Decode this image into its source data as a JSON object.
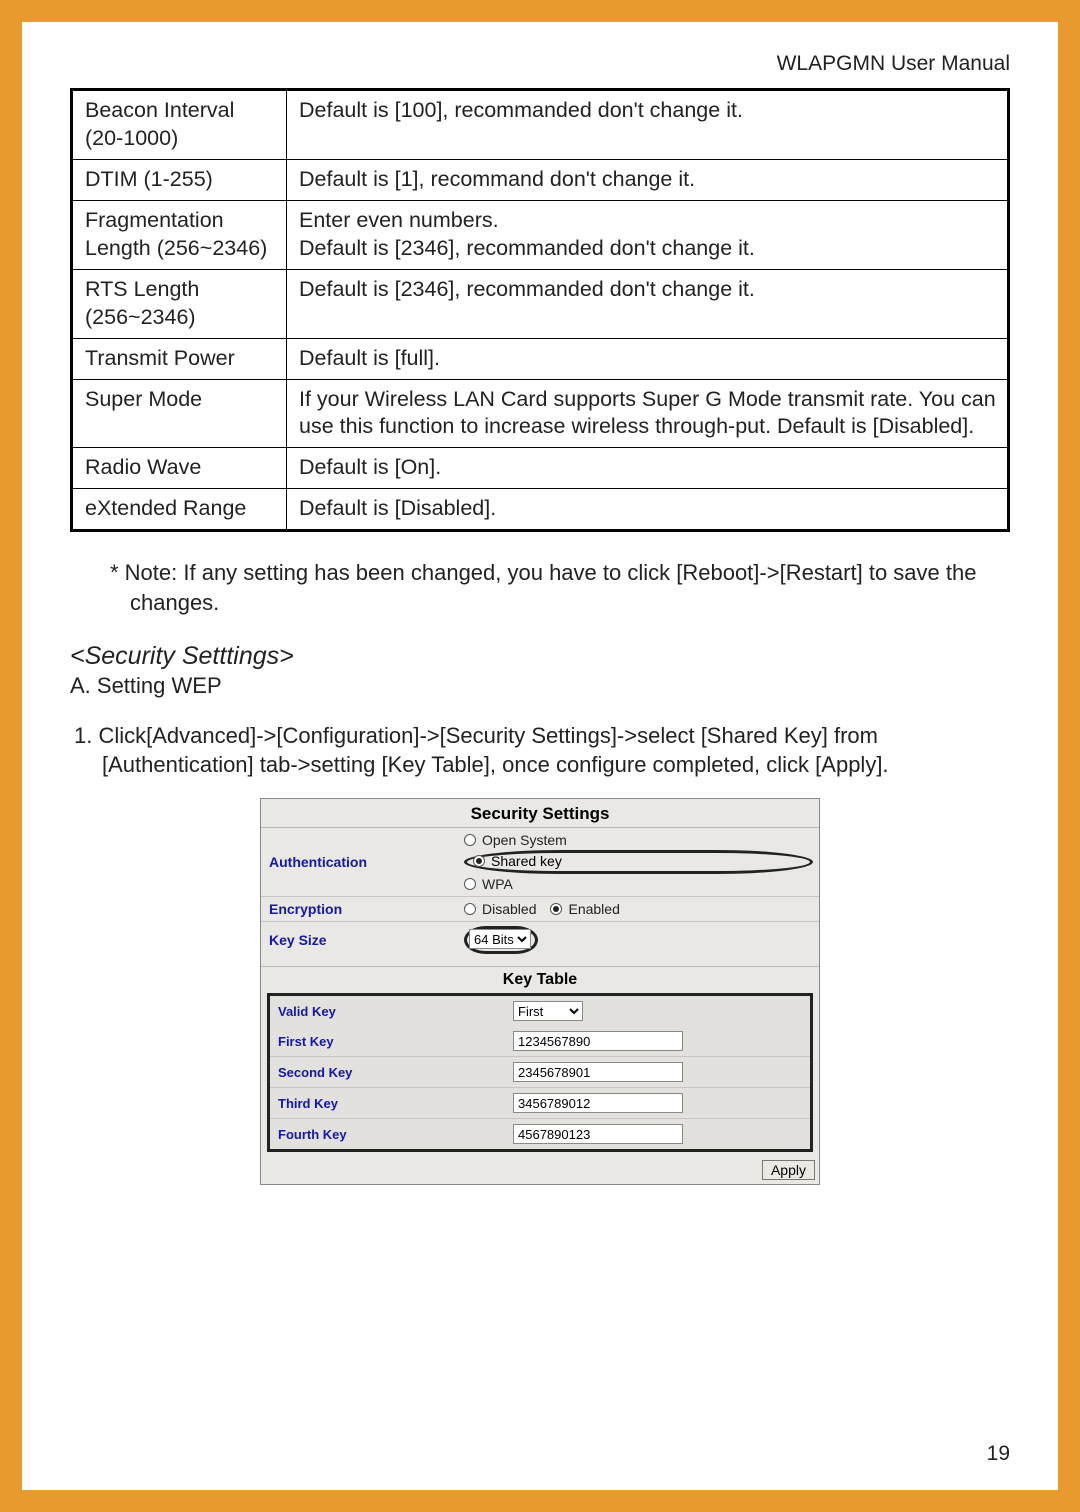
{
  "header": {
    "manual_title": "WLAPGMN User Manual"
  },
  "params_table": {
    "rows": [
      {
        "label": "Beacon Interval (20-1000)",
        "desc": "Default is [100], recommanded don't change it."
      },
      {
        "label": "DTIM (1-255)",
        "desc": "Default is [1], recommand don't change it."
      },
      {
        "label": "Fragmentation Length (256~2346)",
        "desc": "Enter even numbers.\nDefault is [2346], recommanded don't change it."
      },
      {
        "label": "RTS Length (256~2346)",
        "desc": "Default is [2346], recommanded don't change it."
      },
      {
        "label": "Transmit Power",
        "desc": "Default is [full]."
      },
      {
        "label": "Super Mode",
        "desc": "If your Wireless LAN Card supports Super G Mode transmit rate. You can use this function to increase wireless through-put. Default is [Disabled]."
      },
      {
        "label": "Radio Wave",
        "desc": "Default is [On]."
      },
      {
        "label": "eXtended Range",
        "desc": "Default is [Disabled]."
      }
    ]
  },
  "note": "* Note: If any setting has been changed, you have to click [Reboot]->[Restart] to save the changes.",
  "section_title": "<Security Setttings>",
  "subsection": "A. Setting WEP",
  "step1": "1.  Click[Advanced]->[Configuration]->[Security Settings]->select [Shared Key] from [Authentication] tab->setting [Key Table], once configure completed, click [Apply].",
  "security_panel": {
    "title": "Security Settings",
    "authentication": {
      "label": "Authentication",
      "options": {
        "open": "Open System",
        "shared": "Shared key",
        "wpa": "WPA"
      },
      "selected": "shared"
    },
    "encryption": {
      "label": "Encryption",
      "options": {
        "disabled": "Disabled",
        "enabled": "Enabled"
      },
      "selected": "enabled"
    },
    "key_size": {
      "label": "Key Size",
      "value": "64 Bits"
    },
    "key_table": {
      "title": "Key Table",
      "valid_key": {
        "label": "Valid Key",
        "value": "First"
      },
      "rows": [
        {
          "label": "First Key",
          "value": "1234567890"
        },
        {
          "label": "Second Key",
          "value": "2345678901"
        },
        {
          "label": "Third Key",
          "value": "3456789012"
        },
        {
          "label": "Fourth Key",
          "value": "4567890123"
        }
      ],
      "apply_label": "Apply"
    }
  },
  "page_number": "19"
}
